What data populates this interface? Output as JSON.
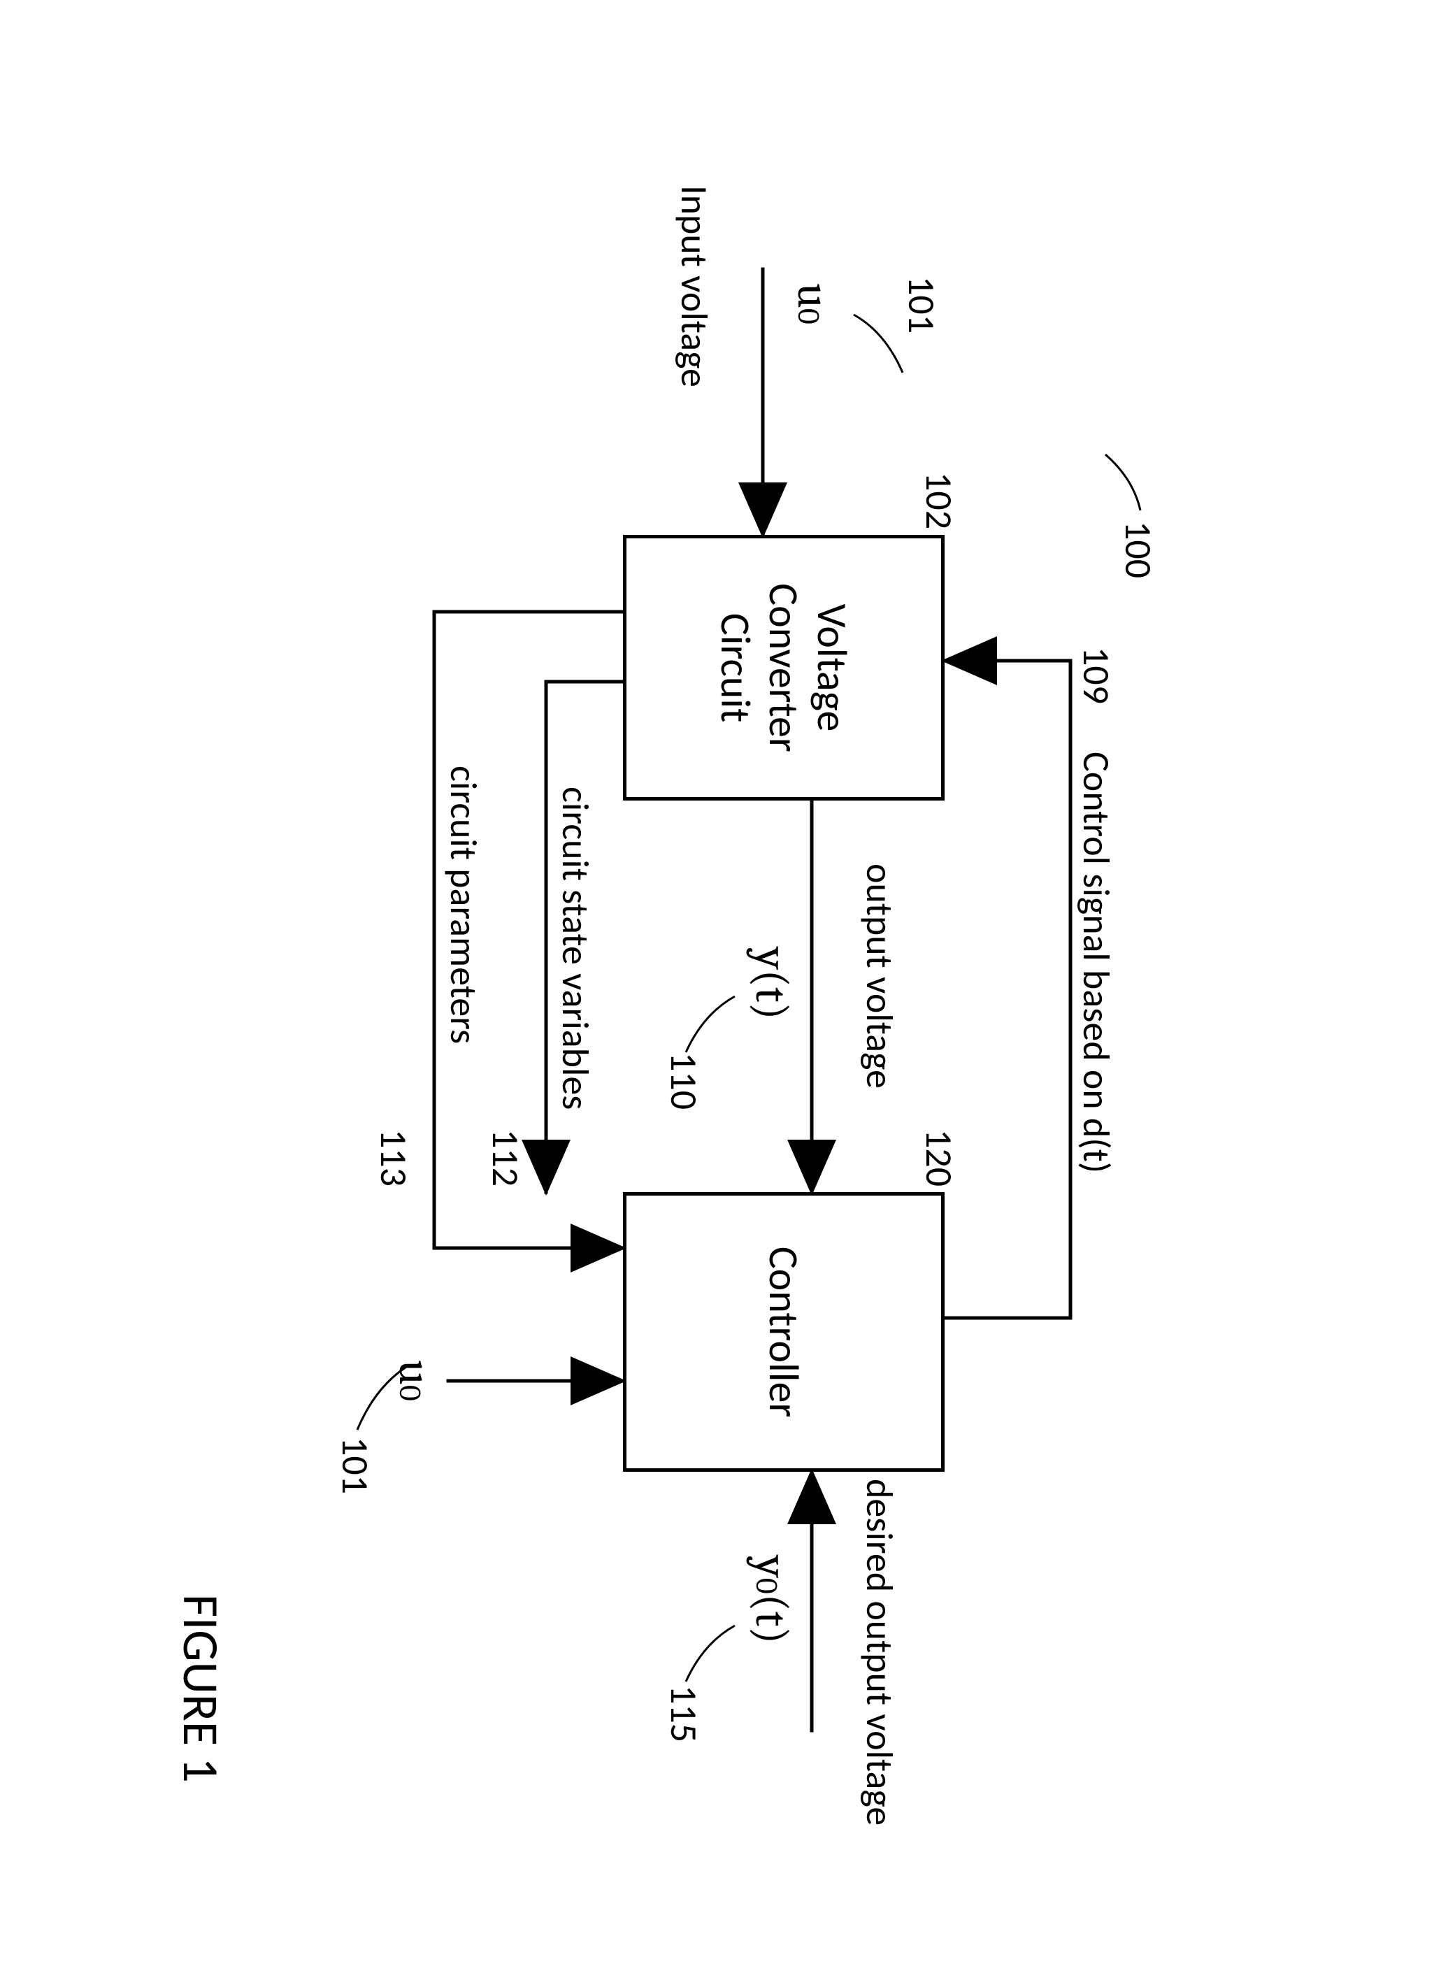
{
  "figure_label": "FIGURE 1",
  "blocks": {
    "vcc": {
      "line1": "Voltage",
      "line2": "Converter",
      "line3": "Circuit"
    },
    "ctrl": "Controller"
  },
  "signals": {
    "input_label": "Input voltage",
    "u0": "u",
    "u0_sub": "0",
    "control_label": "Control signal based on d(t)",
    "output_label": "output voltage",
    "yt": "y(t)",
    "state_vars": "circuit state variables",
    "params": "circuit parameters",
    "desired_label": "desired output voltage",
    "y0": "y",
    "y0_sub": "0",
    "y0_tail": "(t)"
  },
  "refs": {
    "r100": "100",
    "r101a": "101",
    "r102": "102",
    "r109": "109",
    "r110": "110",
    "r120": "120",
    "r112": "112",
    "r113": "113",
    "r115": "115",
    "r101b": "101"
  }
}
